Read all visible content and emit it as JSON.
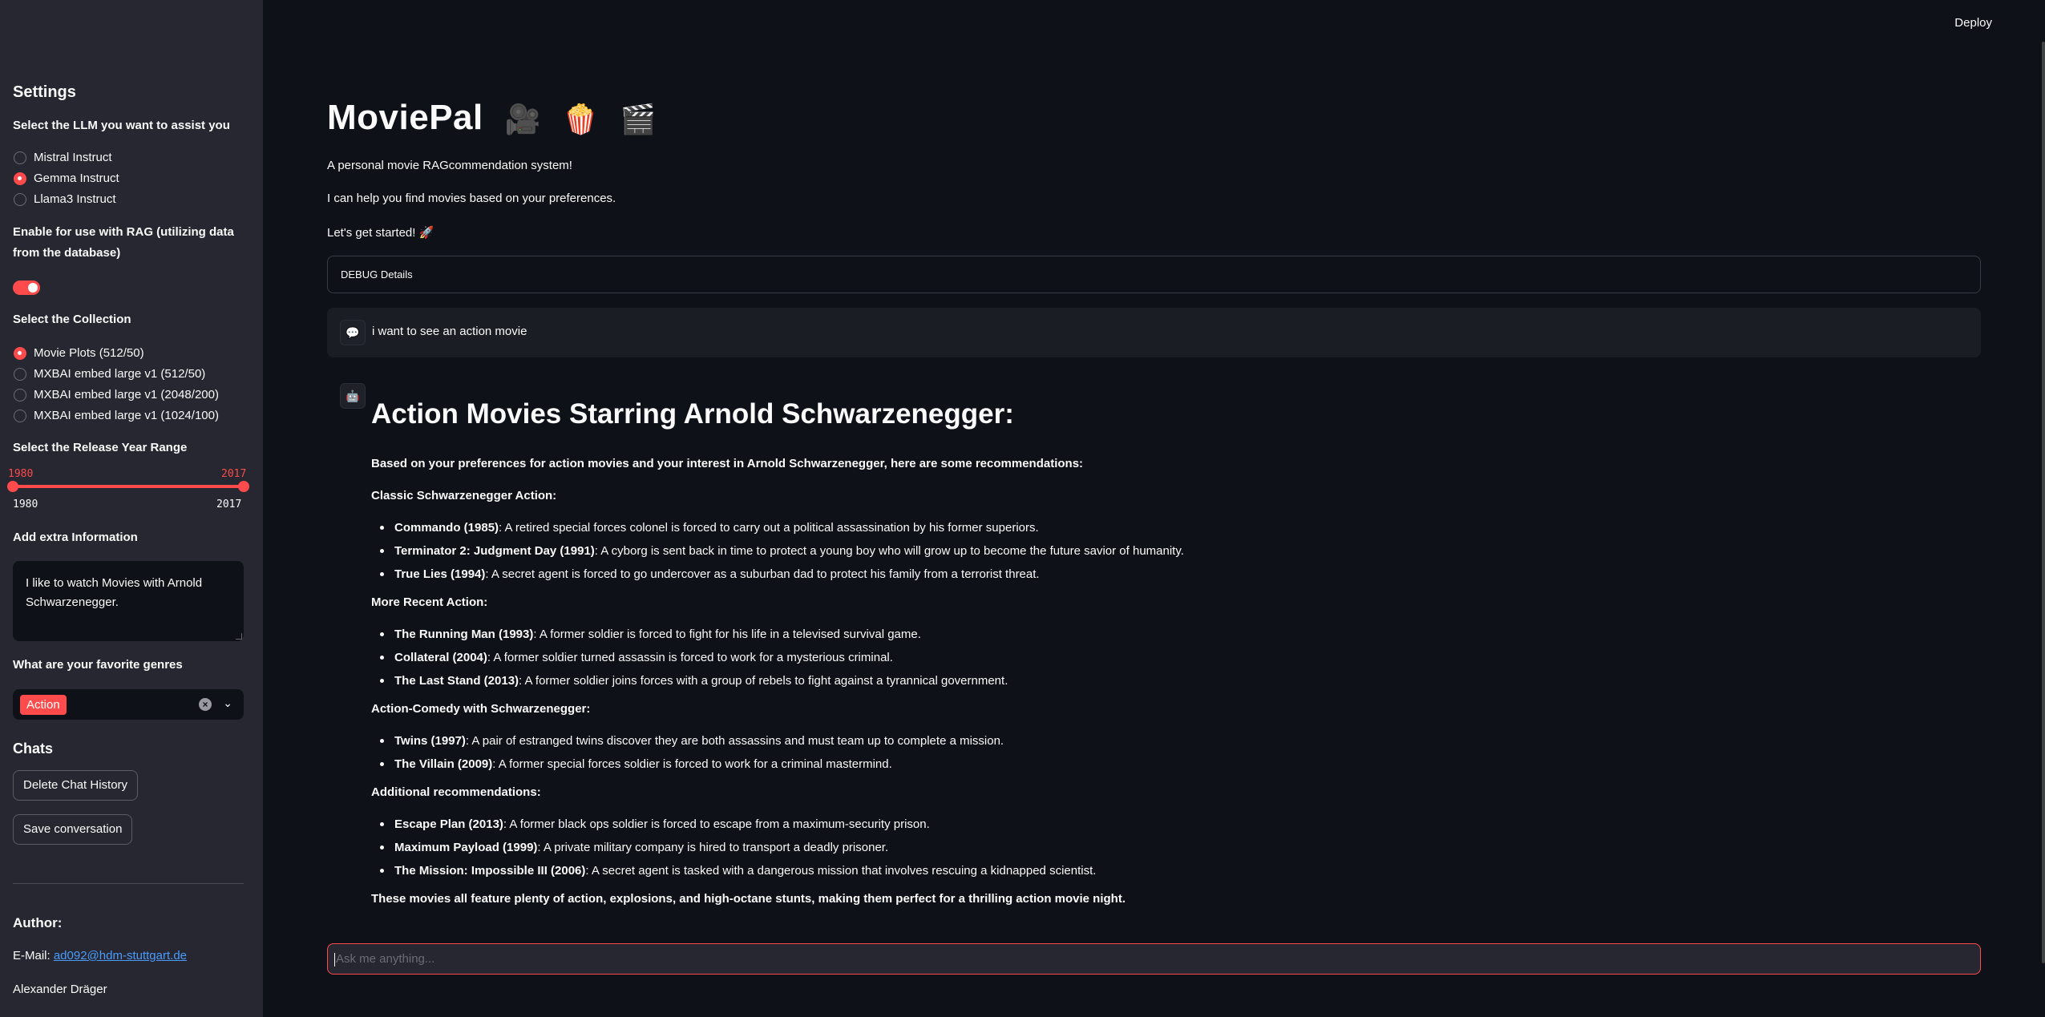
{
  "header": {
    "deploy_label": "Deploy"
  },
  "sidebar": {
    "settings_heading": "Settings",
    "llm_label": "Select the LLM you want to assist you",
    "llm_options": [
      "Mistral Instruct",
      "Gemma Instruct",
      "Llama3 Instruct"
    ],
    "llm_selected": "Gemma Instruct",
    "rag_label_line1": "Enable for use with RAG (utilizing data",
    "rag_label_line2": "from the database)",
    "rag_enabled": true,
    "collection_label": "Select the Collection",
    "collection_options": [
      "Movie Plots (512/50)",
      "MXBAI embed large v1 (512/50)",
      "MXBAI embed large v1 (2048/200)",
      "MXBAI embed large v1 (1024/100)"
    ],
    "collection_selected": "Movie Plots (512/50)",
    "year_label": "Select the Release Year Range",
    "year_min": "1980",
    "year_max": "2017",
    "year_value_low": "1980",
    "year_value_high": "2017",
    "extra_label": "Add extra Information",
    "extra_line1": "I like to watch Movies with Arnold",
    "extra_line2": "Schwarzenegger.",
    "genres_label": "What are your favorite genres",
    "genres_selected": [
      "Action"
    ],
    "chats_heading": "Chats",
    "delete_button": "Delete Chat History",
    "save_button": "Save conversation",
    "author_heading": "Author:",
    "email_prefix": "E-Mail: ",
    "email": "ad092@hdm-stuttgart.de",
    "author_name": "Alexander Dräger"
  },
  "main": {
    "title": "MoviePal",
    "title_emojis": [
      "🎥",
      "🍿",
      "🎬"
    ],
    "intro1": "A personal movie RAGcommendation system!",
    "intro2": "I can help you find movies based on your preferences.",
    "intro3": "Let's get started! 🚀",
    "debug_label": "DEBUG Details",
    "user_message": "i want to see an action movie",
    "response": {
      "heading": "Action Movies Starring Arnold Schwarzenegger:",
      "intro": "Based on your preferences for action movies and your interest in Arnold Schwarzenegger, here are some recommendations:",
      "sections": [
        {
          "title": "Classic Schwarzenegger Action:",
          "items": [
            {
              "name": "Commando (1985)",
              "desc": ": A retired special forces colonel is forced to carry out a political assassination by his former superiors."
            },
            {
              "name": "Terminator 2: Judgment Day (1991)",
              "desc": ": A cyborg is sent back in time to protect a young boy who will grow up to become the future savior of humanity."
            },
            {
              "name": "True Lies (1994)",
              "desc": ": A secret agent is forced to go undercover as a suburban dad to protect his family from a terrorist threat."
            }
          ]
        },
        {
          "title": "More Recent Action:",
          "items": [
            {
              "name": "The Running Man (1993)",
              "desc": ": A former soldier is forced to fight for his life in a televised survival game."
            },
            {
              "name": "Collateral (2004)",
              "desc": ": A former soldier turned assassin is forced to work for a mysterious criminal."
            },
            {
              "name": "The Last Stand (2013)",
              "desc": ": A former soldier joins forces with a group of rebels to fight against a tyrannical government."
            }
          ]
        },
        {
          "title": "Action-Comedy with Schwarzenegger:",
          "items": [
            {
              "name": "Twins (1997)",
              "desc": ": A pair of estranged twins discover they are both assassins and must team up to complete a mission."
            },
            {
              "name": "The Villain (2009)",
              "desc": ": A former special forces soldier is forced to work for a criminal mastermind."
            }
          ]
        },
        {
          "title": "Additional recommendations:",
          "items": [
            {
              "name": "Escape Plan (2013)",
              "desc": ": A former black ops soldier is forced to escape from a maximum-security prison."
            },
            {
              "name": "Maximum Payload (1999)",
              "desc": ": A private military company is hired to transport a deadly prisoner."
            },
            {
              "name": "The Mission: Impossible III (2006)",
              "desc": ": A secret agent is tasked with a dangerous mission that involves rescuing a kidnapped scientist."
            }
          ]
        }
      ],
      "outro": "These movies all feature plenty of action, explosions, and high-octane stunts, making them perfect for a thrilling action movie night."
    },
    "chat_placeholder": "Ask me anything..."
  }
}
